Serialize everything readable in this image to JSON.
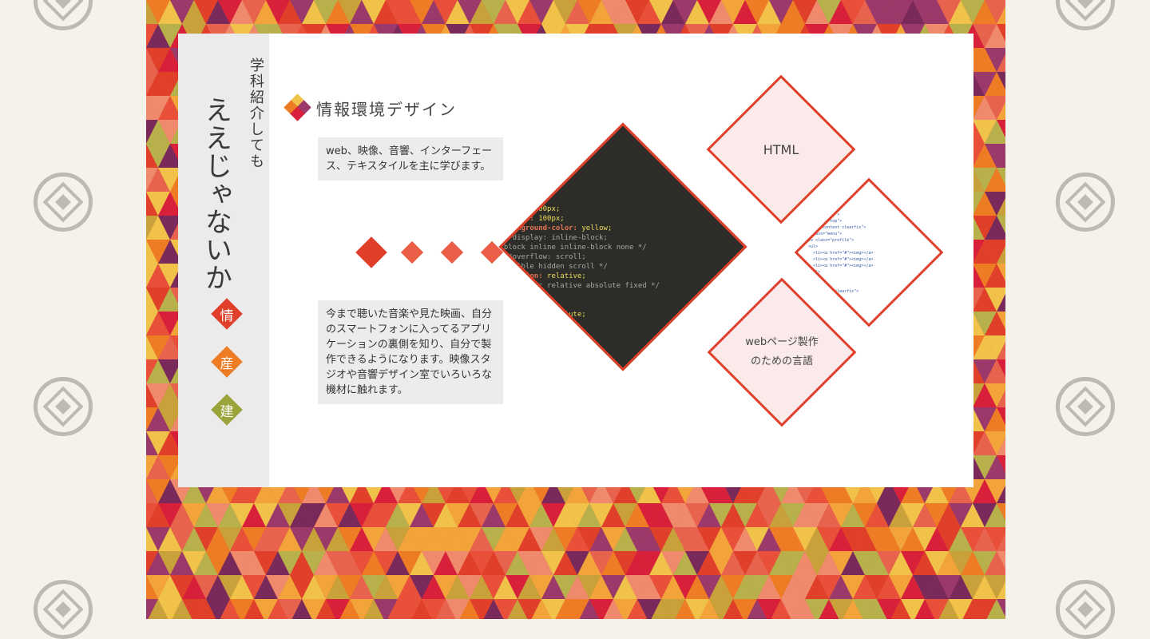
{
  "sidebar": {
    "subtitle": "学科紹介しても",
    "title": "ええじゃないか",
    "nav": [
      {
        "label": "情",
        "color": "#e0402a"
      },
      {
        "label": "産",
        "color": "#ee7c24"
      },
      {
        "label": "建",
        "color": "#9aa43a"
      }
    ]
  },
  "section": {
    "title": "情報環境デザイン",
    "intro": "web、映像、音響、インターフェース、テキスタイルを主に学びます。",
    "detail": "今まで聴いた音楽や見た映画、自分のスマートフォンに入ってるアプリケーションの裏側を知り、自分で製作できるようになります。映像スタジオや音響デザイン室でいろいろな機材に触れます。"
  },
  "cards": {
    "html_label": "HTML",
    "web_label_line1": "webページ製作",
    "web_label_line2": "のための言語"
  },
  "colors": {
    "accent": "#e0402a",
    "dot": "#ea5e48",
    "card_bg": "#fbeaea",
    "sidebar_bg": "#ebebeb"
  }
}
